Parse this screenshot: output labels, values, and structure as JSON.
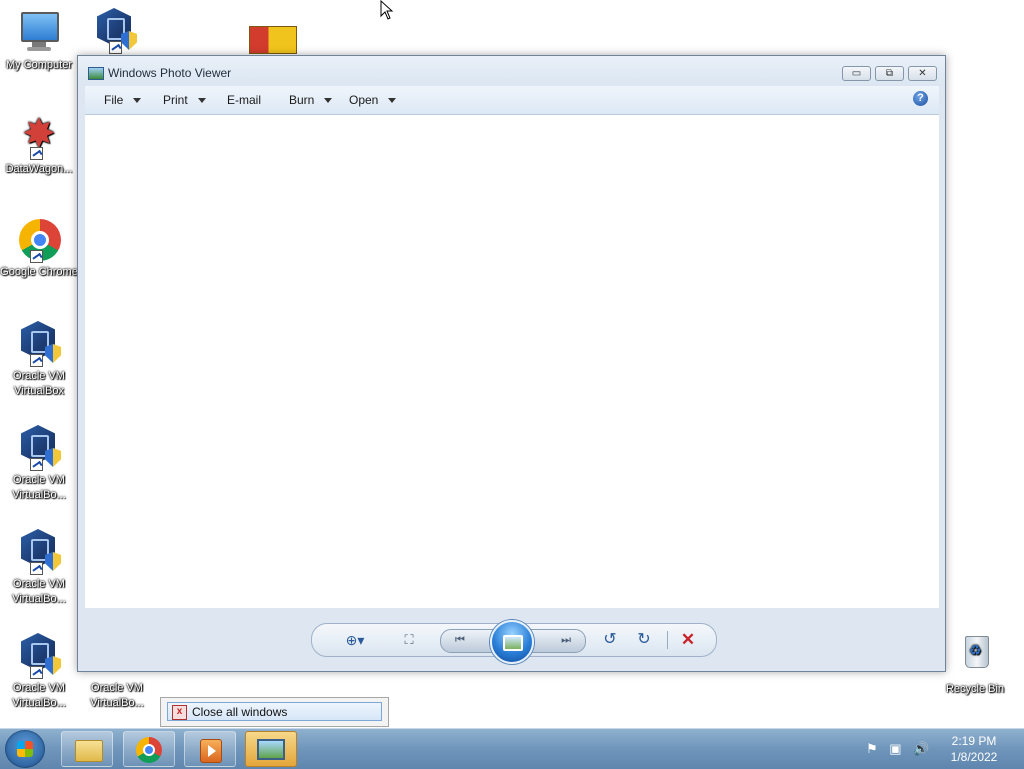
{
  "desktop": {
    "icons": [
      {
        "label": "My Computer"
      },
      {
        "label": "DataWagon..."
      },
      {
        "label": "Google Chrome"
      },
      {
        "label": "Oracle VM VirtualBox"
      },
      {
        "label": "Oracle VM VirtualBo..."
      },
      {
        "label": "Oracle VM VirtualBo..."
      },
      {
        "label": "Oracle VM VirtualBo..."
      },
      {
        "label": "Oracle VM VirtualBo..."
      },
      {
        "label": "Recycle Bin"
      }
    ]
  },
  "window": {
    "title": "Windows Photo Viewer",
    "controls": {
      "minimize": "▭",
      "maximize": "⧉",
      "close": "✕"
    },
    "menu": [
      {
        "label": "File",
        "has_dropdown": true
      },
      {
        "label": "Print",
        "has_dropdown": true
      },
      {
        "label": "E-mail",
        "has_dropdown": false
      },
      {
        "label": "Burn",
        "has_dropdown": true
      },
      {
        "label": "Open",
        "has_dropdown": true
      }
    ],
    "help_label": "?",
    "controls_bar": {
      "zoom": "⊕▾",
      "fit": "⛶",
      "previous": "⏮",
      "next": "⏭",
      "rotate_left": "↺",
      "rotate_right": "↻",
      "delete": "✕"
    }
  },
  "popup": {
    "close_all_label": "Close all windows",
    "close_icon_glyph": "x"
  },
  "taskbar": {
    "pinned": [
      "windows-explorer",
      "google-chrome",
      "windows-media-player",
      "windows-photo-viewer"
    ],
    "tray_icons": [
      "⚑",
      "▣",
      "🔊"
    ],
    "time": "2:19 PM",
    "date": "1/8/2022"
  },
  "colors": {
    "window_bg": "#dde6f1",
    "taskbar": "#6f95bb",
    "delete_red": "#c8232c"
  }
}
